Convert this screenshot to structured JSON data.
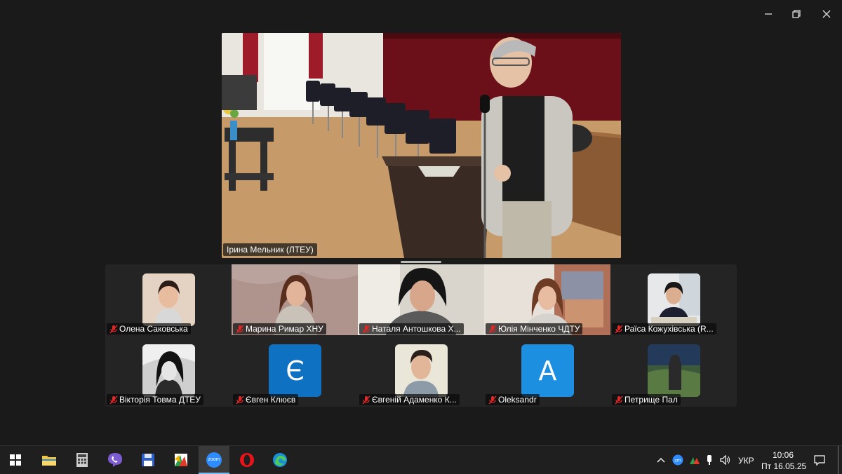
{
  "window": {
    "minimize_icon": "minimize-icon",
    "restore_icon": "restore-icon",
    "close_icon": "close-icon"
  },
  "speaker": {
    "name": "Ірина Мельник  (ЛТЕУ)"
  },
  "participants": [
    {
      "name": "Олена Саковська",
      "kind": "photo",
      "muted": true
    },
    {
      "name": "Марина Римар ХНУ",
      "kind": "video",
      "muted": true
    },
    {
      "name": "Наталя Антошкова Х...",
      "kind": "video",
      "muted": true
    },
    {
      "name": "Юлія Мінченко ЧДТУ",
      "kind": "video",
      "muted": true
    },
    {
      "name": "Раїса Кожухівська (R...",
      "kind": "photo",
      "muted": true
    },
    {
      "name": "Вікторія Товма ДТЕУ",
      "kind": "photo",
      "muted": true
    },
    {
      "name": "Євген Клюєв",
      "kind": "letter",
      "letter": "Є",
      "muted": true
    },
    {
      "name": "Євгеній Адаменко К...",
      "kind": "photo",
      "muted": true
    },
    {
      "name": "Oleksandr",
      "kind": "letter",
      "letter": "A",
      "muted": true
    },
    {
      "name": "Петрище Пал",
      "kind": "photo",
      "muted": true
    }
  ],
  "taskbar": {
    "apps": [
      "windows-start",
      "file-explorer",
      "calculator",
      "viber",
      "save-app",
      "colorful-app",
      "zoom",
      "opera",
      "edge"
    ],
    "active_app": "zoom",
    "zoom_label": "zoom",
    "tray": {
      "language": "УКР",
      "time": "10:06",
      "date": "Пт 16.05.25"
    }
  },
  "colors": {
    "background": "#1a1a1a",
    "gallery": "#242424",
    "letter_avatar": "#0e71c2",
    "muted_icon": "#e02828",
    "zoom_blue": "#2d8cff",
    "opera_red": "#e8131b"
  }
}
